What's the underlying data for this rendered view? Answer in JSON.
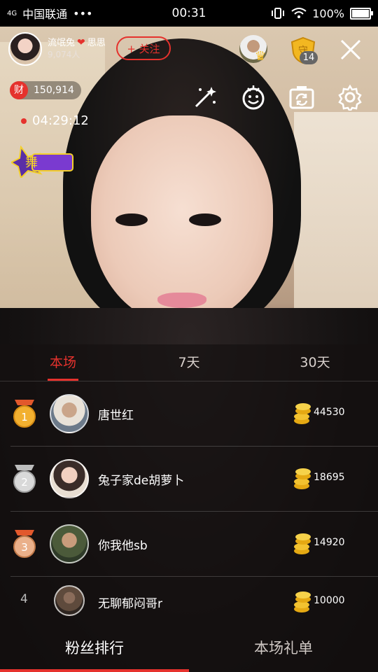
{
  "status_bar": {
    "signal_label": "4G",
    "carrier": "中国联通",
    "dots": "•••",
    "time": "00:31",
    "battery": "100%"
  },
  "host": {
    "name_left": "流氓兔",
    "name_right": "思思",
    "viewers": "9,074人",
    "follow_label": "+ 关注"
  },
  "guard_badge": {
    "count": "14",
    "glyph": "守"
  },
  "wealth": {
    "icon_text": "财",
    "value": "150,914"
  },
  "live_timer": "04:29:12",
  "promo_text": "舞",
  "tabs": [
    {
      "label": "本场"
    },
    {
      "label": "7天"
    },
    {
      "label": "30天"
    }
  ],
  "ranking": [
    {
      "rank": "1",
      "name": "唐世红",
      "score": "44530"
    },
    {
      "rank": "2",
      "name": "兔子家de胡萝卜",
      "score": "18695"
    },
    {
      "rank": "3",
      "name": "你我他sb",
      "score": "14920"
    },
    {
      "rank": "4",
      "name": "无聊郁闷哥r",
      "score": "10000"
    }
  ],
  "bottom_tabs": [
    {
      "label": "粉丝排行"
    },
    {
      "label": "本场礼单"
    }
  ],
  "colors": {
    "accent": "#e5322d",
    "gold": "#f2c230"
  },
  "icons": [
    "magic-wand-icon",
    "beauty-face-icon",
    "camera-switch-icon",
    "settings-gear-icon",
    "close-icon"
  ]
}
